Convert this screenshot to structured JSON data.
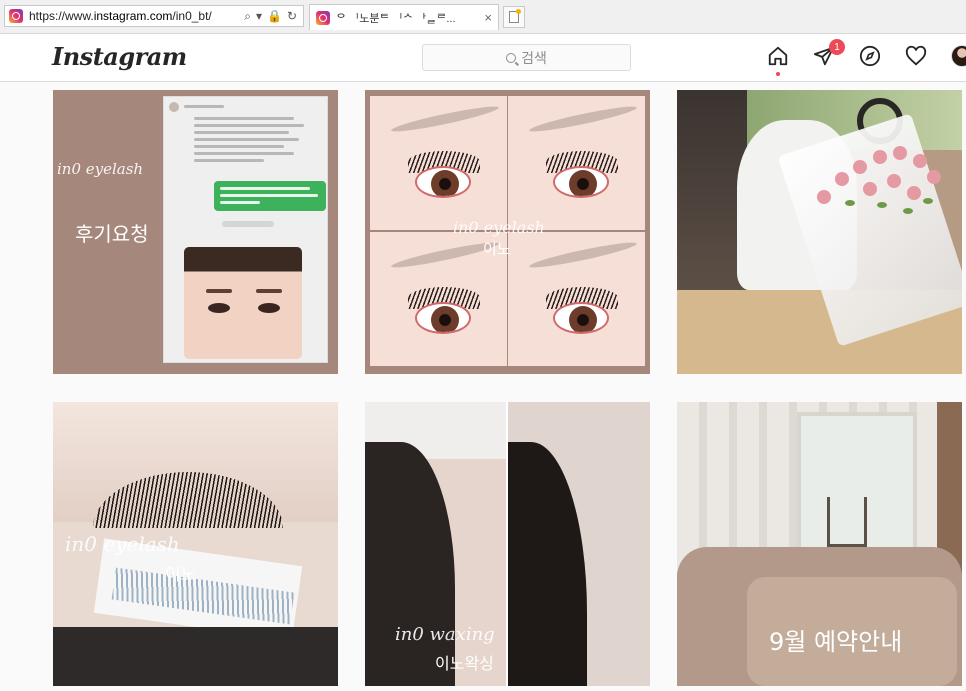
{
  "browser": {
    "url_prefix": "https://www.",
    "url_domain": "instagram.com",
    "url_path": "/in0_bt/",
    "addr_icons": [
      "⌕",
      "▾",
      "🔒",
      "↻"
    ],
    "tab_title": "ᄋ ᅵ노분ᄐ ᅵᄉ ᅡᆯᄅ...",
    "tab_close": "×"
  },
  "header": {
    "logo": "Instagram",
    "search_placeholder": "검색",
    "notification_count": "1"
  },
  "posts": [
    {
      "script": "in0 eyelash",
      "korean": "후기요청"
    },
    {
      "script": "in0 eyelash",
      "korean": "이노"
    },
    {
      "script": "",
      "korean": ""
    },
    {
      "script": "in0 eyelash",
      "korean": "이노"
    },
    {
      "script": "in0 waxing",
      "korean": "이노왁싱"
    },
    {
      "script": "",
      "korean": "9월 예약안내"
    }
  ]
}
